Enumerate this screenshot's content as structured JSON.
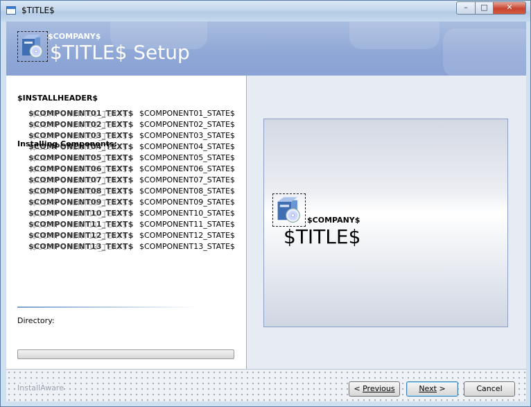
{
  "window": {
    "title": "$TITLE$"
  },
  "banner": {
    "company": "$COMPANY$",
    "title": "$TITLE$ Setup",
    "logo_icon": "setup-box-cd-icon"
  },
  "left": {
    "header": "$INSTALLHEADER$",
    "installing_label": "Installing Components:",
    "components": [
      {
        "text": "$COMPONENT01_TEXT$",
        "state": "$COMPONENT01_STATE$"
      },
      {
        "text": "$COMPONENT02_TEXT$",
        "state": "$COMPONENT02_STATE$"
      },
      {
        "text": "$COMPONENT03_TEXT$",
        "state": "$COMPONENT03_STATE$"
      },
      {
        "text": "$COMPONENT04_TEXT$",
        "state": "$COMPONENT04_STATE$"
      },
      {
        "text": "$COMPONENT05_TEXT$",
        "state": "$COMPONENT05_STATE$"
      },
      {
        "text": "$COMPONENT06_TEXT$",
        "state": "$COMPONENT06_STATE$"
      },
      {
        "text": "$COMPONENT07_TEXT$",
        "state": "$COMPONENT07_STATE$"
      },
      {
        "text": "$COMPONENT08_TEXT$",
        "state": "$COMPONENT08_STATE$"
      },
      {
        "text": "$COMPONENT09_TEXT$",
        "state": "$COMPONENT09_STATE$"
      },
      {
        "text": "$COMPONENT10_TEXT$",
        "state": "$COMPONENT10_STATE$"
      },
      {
        "text": "$COMPONENT11_TEXT$",
        "state": "$COMPONENT11_STATE$"
      },
      {
        "text": "$COMPONENT12_TEXT$",
        "state": "$COMPONENT12_STATE$"
      },
      {
        "text": "$COMPONENT13_TEXT$",
        "state": "$COMPONENT13_STATE$"
      }
    ],
    "directory_label": "Directory:",
    "progress": 0
  },
  "right": {
    "company": "$COMPANY$",
    "title": "$TITLE$",
    "logo_icon": "setup-box-cd-icon"
  },
  "footer": {
    "brand": "InstallAware",
    "previous_label": "Previous",
    "previous_prefix": "< ",
    "next_label": "Next",
    "next_suffix": " >",
    "cancel_label": "Cancel"
  }
}
